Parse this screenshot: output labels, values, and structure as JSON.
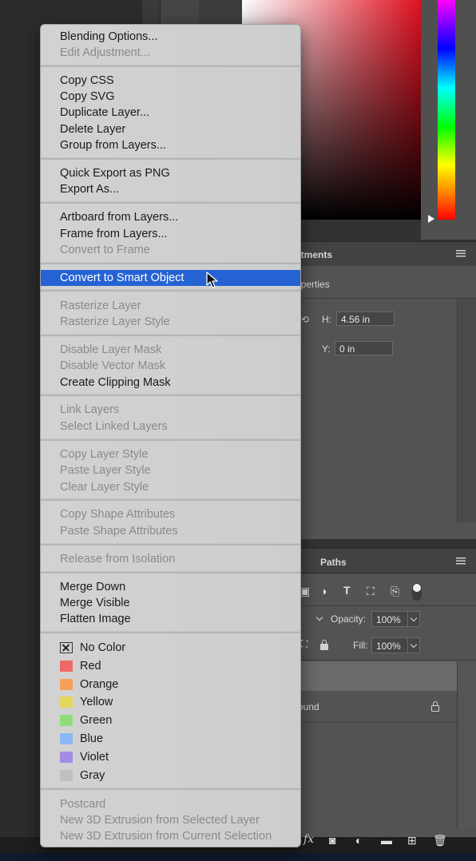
{
  "background": {
    "adjustments_tab": "stments",
    "properties_tab": "operties",
    "h_label": "H:",
    "h_value": "4.56 in",
    "y_label": "Y:",
    "y_value": "0 in",
    "paths_tab": "Paths",
    "opacity_label": "Opacity:",
    "opacity_value": "100%",
    "fill_label": "Fill:",
    "fill_value": "100%",
    "layer_name": "ound",
    "fx_label": "fx",
    "hue_colors": [
      "#ff00ff",
      "#0000ff",
      "#00ffff",
      "#00ff00",
      "#ffff00",
      "#ff0000"
    ]
  },
  "menu": {
    "group1": [
      {
        "label": "Blending Options...",
        "enabled": true
      },
      {
        "label": "Edit Adjustment...",
        "enabled": false
      }
    ],
    "group2": [
      {
        "label": "Copy CSS",
        "enabled": true
      },
      {
        "label": "Copy SVG",
        "enabled": true
      },
      {
        "label": "Duplicate Layer...",
        "enabled": true
      },
      {
        "label": "Delete Layer",
        "enabled": true
      },
      {
        "label": "Group from Layers...",
        "enabled": true
      }
    ],
    "group3": [
      {
        "label": "Quick Export as PNG",
        "enabled": true
      },
      {
        "label": "Export As...",
        "enabled": true
      }
    ],
    "group4": [
      {
        "label": "Artboard from Layers...",
        "enabled": true
      },
      {
        "label": "Frame from Layers...",
        "enabled": true
      },
      {
        "label": "Convert to Frame",
        "enabled": false
      }
    ],
    "group5": [
      {
        "label": "Convert to Smart Object",
        "enabled": true,
        "highlighted": true
      }
    ],
    "group6": [
      {
        "label": "Rasterize Layer",
        "enabled": false
      },
      {
        "label": "Rasterize Layer Style",
        "enabled": false
      }
    ],
    "group7": [
      {
        "label": "Disable Layer Mask",
        "enabled": false
      },
      {
        "label": "Disable Vector Mask",
        "enabled": false
      },
      {
        "label": "Create Clipping Mask",
        "enabled": true
      }
    ],
    "group8": [
      {
        "label": "Link Layers",
        "enabled": false
      },
      {
        "label": "Select Linked Layers",
        "enabled": false
      }
    ],
    "group9": [
      {
        "label": "Copy Layer Style",
        "enabled": false
      },
      {
        "label": "Paste Layer Style",
        "enabled": false
      },
      {
        "label": "Clear Layer Style",
        "enabled": false
      }
    ],
    "group10": [
      {
        "label": "Copy Shape Attributes",
        "enabled": false
      },
      {
        "label": "Paste Shape Attributes",
        "enabled": false
      }
    ],
    "group11": [
      {
        "label": "Release from Isolation",
        "enabled": false
      }
    ],
    "group12": [
      {
        "label": "Merge Down",
        "enabled": true
      },
      {
        "label": "Merge Visible",
        "enabled": true
      },
      {
        "label": "Flatten Image",
        "enabled": true
      }
    ],
    "colors": [
      {
        "label": "No Color",
        "swatch": "none"
      },
      {
        "label": "Red",
        "swatch": "#f06868"
      },
      {
        "label": "Orange",
        "swatch": "#f5a05a"
      },
      {
        "label": "Yellow",
        "swatch": "#e6d75c"
      },
      {
        "label": "Green",
        "swatch": "#8fdc7c"
      },
      {
        "label": "Blue",
        "swatch": "#8ab8f4"
      },
      {
        "label": "Violet",
        "swatch": "#a38be4"
      },
      {
        "label": "Gray",
        "swatch": "#c0c0c0"
      }
    ],
    "group14": [
      {
        "label": "Postcard",
        "enabled": false
      },
      {
        "label": "New 3D Extrusion from Selected Layer",
        "enabled": false
      },
      {
        "label": "New 3D Extrusion from Current Selection",
        "enabled": false
      }
    ]
  }
}
